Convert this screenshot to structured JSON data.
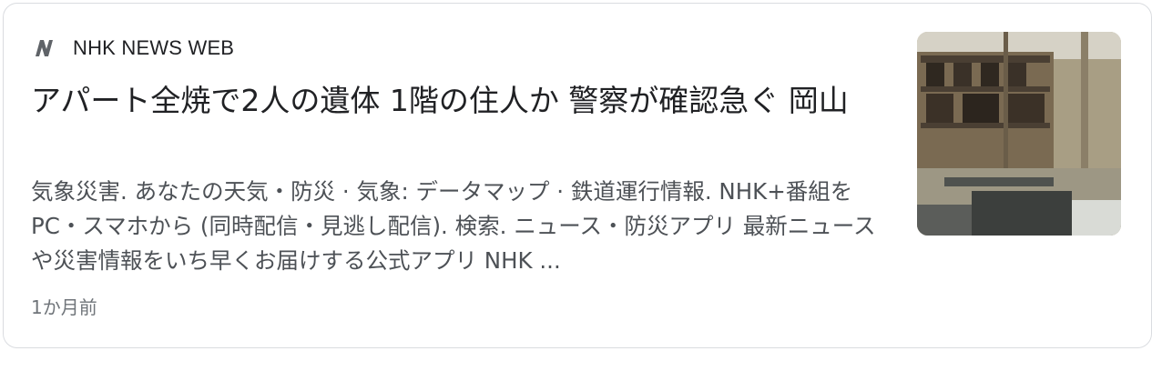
{
  "article": {
    "source": {
      "name": "NHK NEWS WEB",
      "logo_icon": "nhk-logo-icon"
    },
    "headline": "アパート全焼で2人の遺体 1階の住人か 警察が確認急ぐ 岡山",
    "snippet": "気象災害. あなたの天気・防災 · 気象: データマップ · 鉄道運行情報. NHK+番組をPC・スマホから (同時配信・見逃し配信). 検索. ニュース・防災アプリ 最新ニュースや災害情報をいち早くお届けする公式アプリ NHK ...",
    "timestamp": "1か月前",
    "thumbnail": "burned-apartment-photo"
  },
  "colors": {
    "headline": "#202124",
    "snippet": "#4d5156",
    "timestamp": "#70757a",
    "border": "#dadce0"
  }
}
